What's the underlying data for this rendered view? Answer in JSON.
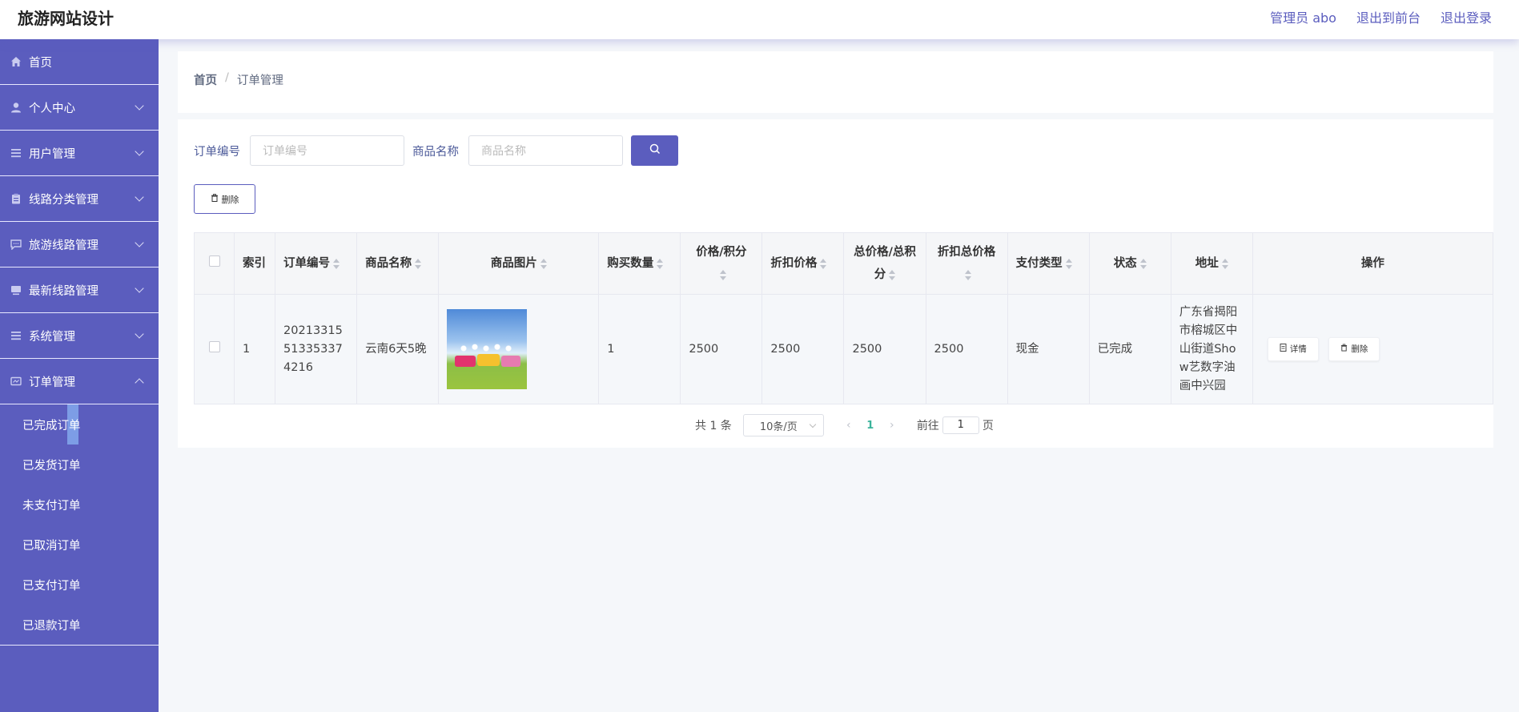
{
  "app": {
    "title": "旅游网站设计"
  },
  "header": {
    "admin": "管理员 abo",
    "to_front": "退出到前台",
    "logout": "退出登录"
  },
  "sidebar": {
    "items": [
      {
        "label": "首页",
        "icon": "home-icon"
      },
      {
        "label": "个人中心",
        "icon": "user-icon"
      },
      {
        "label": "用户管理",
        "icon": "list-icon"
      },
      {
        "label": "线路分类管理",
        "icon": "clipboard-icon"
      },
      {
        "label": "旅游线路管理",
        "icon": "chat-icon"
      },
      {
        "label": "最新线路管理",
        "icon": "monitor-icon"
      },
      {
        "label": "系统管理",
        "icon": "list-icon"
      },
      {
        "label": "订单管理",
        "icon": "card-icon"
      }
    ],
    "sub_items": [
      "已完成订单",
      "已发货订单",
      "未支付订单",
      "已取消订单",
      "已支付订单",
      "已退款订单"
    ]
  },
  "breadcrumb": {
    "home": "首页",
    "separator": "/",
    "current": "订单管理"
  },
  "search": {
    "order_no_label": "订单编号",
    "order_no_placeholder": "订单编号",
    "goods_name_label": "商品名称",
    "goods_name_placeholder": "商品名称"
  },
  "toolbar": {
    "delete_label": "删除"
  },
  "table": {
    "headers": {
      "index": "索引",
      "order_no": "订单编号",
      "goods_name": "商品名称",
      "goods_image": "商品图片",
      "quantity": "购买数量",
      "price": "价格/积分",
      "discount_price": "折扣价格",
      "total_price": "总价格/总积分",
      "discount_total": "折扣总价格",
      "pay_type": "支付类型",
      "status": "状态",
      "address": "地址",
      "actions": "操作"
    },
    "rows": [
      {
        "index": "1",
        "order_no": "20213315513353374216",
        "goods_name": "云南6天5晚",
        "quantity": "1",
        "price": "2500",
        "discount_price": "2500",
        "total_price": "2500",
        "discount_total": "2500",
        "pay_type": "现金",
        "status": "已完成",
        "address": "广东省揭阳市榕城区中山街道Show艺数字油画中兴园",
        "detail_label": "详情",
        "delete_label": "删除"
      }
    ]
  },
  "pagination": {
    "total": "共 1 条",
    "page_size": "10条/页",
    "current_page": "1",
    "goto_prefix": "前往",
    "goto_value": "1",
    "goto_suffix": "页"
  },
  "colors": {
    "primary": "#5b5dbe",
    "active_page": "#3bb39b"
  }
}
